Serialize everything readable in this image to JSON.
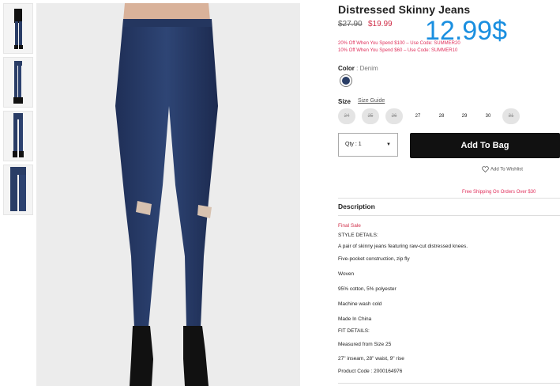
{
  "product": {
    "title": "Distressed Skinny Jeans",
    "original_price": "$27.90",
    "sale_price": "$19.99",
    "overlay_price": "12.99$",
    "promo_lines": [
      "20% Off When You Spend $100 – Use Code: SUMMER20",
      "10% Off When You Spend $60 – Use Code: SUMMER10"
    ]
  },
  "color": {
    "label": "Color",
    "value": ": Denim",
    "swatch_hex": "#2a3d66"
  },
  "size": {
    "label": "Size",
    "guide_label": "Size Guide",
    "options": [
      {
        "label": "24",
        "available": false
      },
      {
        "label": "25",
        "available": false
      },
      {
        "label": "26",
        "available": false
      },
      {
        "label": "27",
        "available": true
      },
      {
        "label": "28",
        "available": true
      },
      {
        "label": "29",
        "available": true
      },
      {
        "label": "30",
        "available": true
      },
      {
        "label": "31",
        "available": false
      }
    ]
  },
  "actions": {
    "qty_label": "Qty : 1",
    "add_to_bag": "Add To Bag",
    "wishlist": "Add To Wishlist",
    "free_shipping": "Free Shipping On Orders Over $30"
  },
  "description": {
    "title": "Description",
    "lines": [
      "Final Sale",
      "STYLE DETAILS:",
      "A pair of skinny jeans featuring raw-cut distressed knees.",
      "Five-pocket construction, zip fly",
      "Woven",
      "95% cotton, 5% polyester",
      "Machine wash cold",
      "Made In China",
      "FIT DETAILS:",
      "Measured from Size 25",
      "27\" inseam, 28\" waist, 9\" rise",
      "Product Code : 2000164976"
    ]
  },
  "colors": {
    "sale_red": "#d0304a",
    "promo_pink": "#e0305c",
    "price_blue": "#1a8fe0",
    "denim": "#2a3d66"
  }
}
